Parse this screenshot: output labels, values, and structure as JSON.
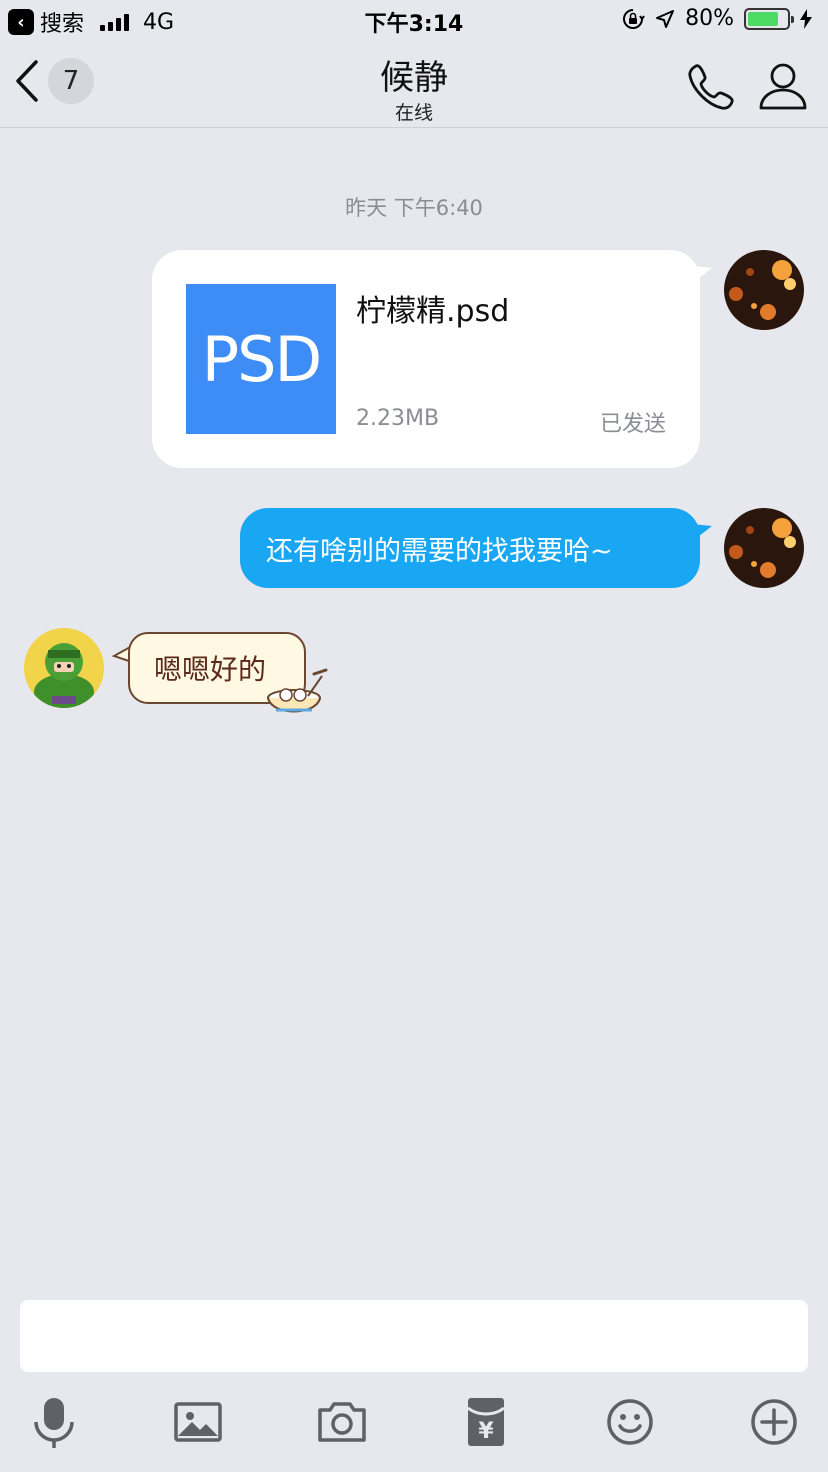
{
  "status_bar": {
    "back_app_label": "搜索",
    "network": "4G",
    "time": "下午3:14",
    "battery_percent": "80%",
    "battery_level": 0.8,
    "battery_color": "#4cd964",
    "icons": [
      "signal-icon",
      "rotation-lock-icon",
      "location-icon",
      "battery-icon",
      "charging-icon"
    ]
  },
  "nav": {
    "unread_count": "7",
    "contact_name": "候静",
    "presence": "在线",
    "icons": [
      "back-chevron-icon",
      "phone-icon",
      "profile-icon"
    ]
  },
  "chat": {
    "timestamp": "昨天 下午6:40",
    "file_message": {
      "thumb_label": "PSD",
      "file_name": "柠檬精.psd",
      "file_size": "2.23MB",
      "status": "已发送",
      "thumb_color": "#3e8df7"
    },
    "text_message": {
      "text": "还有啥别的需要的找我要哈~",
      "bubble_color": "#19a6f2"
    },
    "reply_message": {
      "text": "嗯嗯好的"
    }
  },
  "composer": {
    "input_value": "",
    "toolbar_icons": [
      "microphone-icon",
      "image-icon",
      "camera-icon",
      "red-packet-icon",
      "emoji-icon",
      "plus-icon"
    ]
  }
}
